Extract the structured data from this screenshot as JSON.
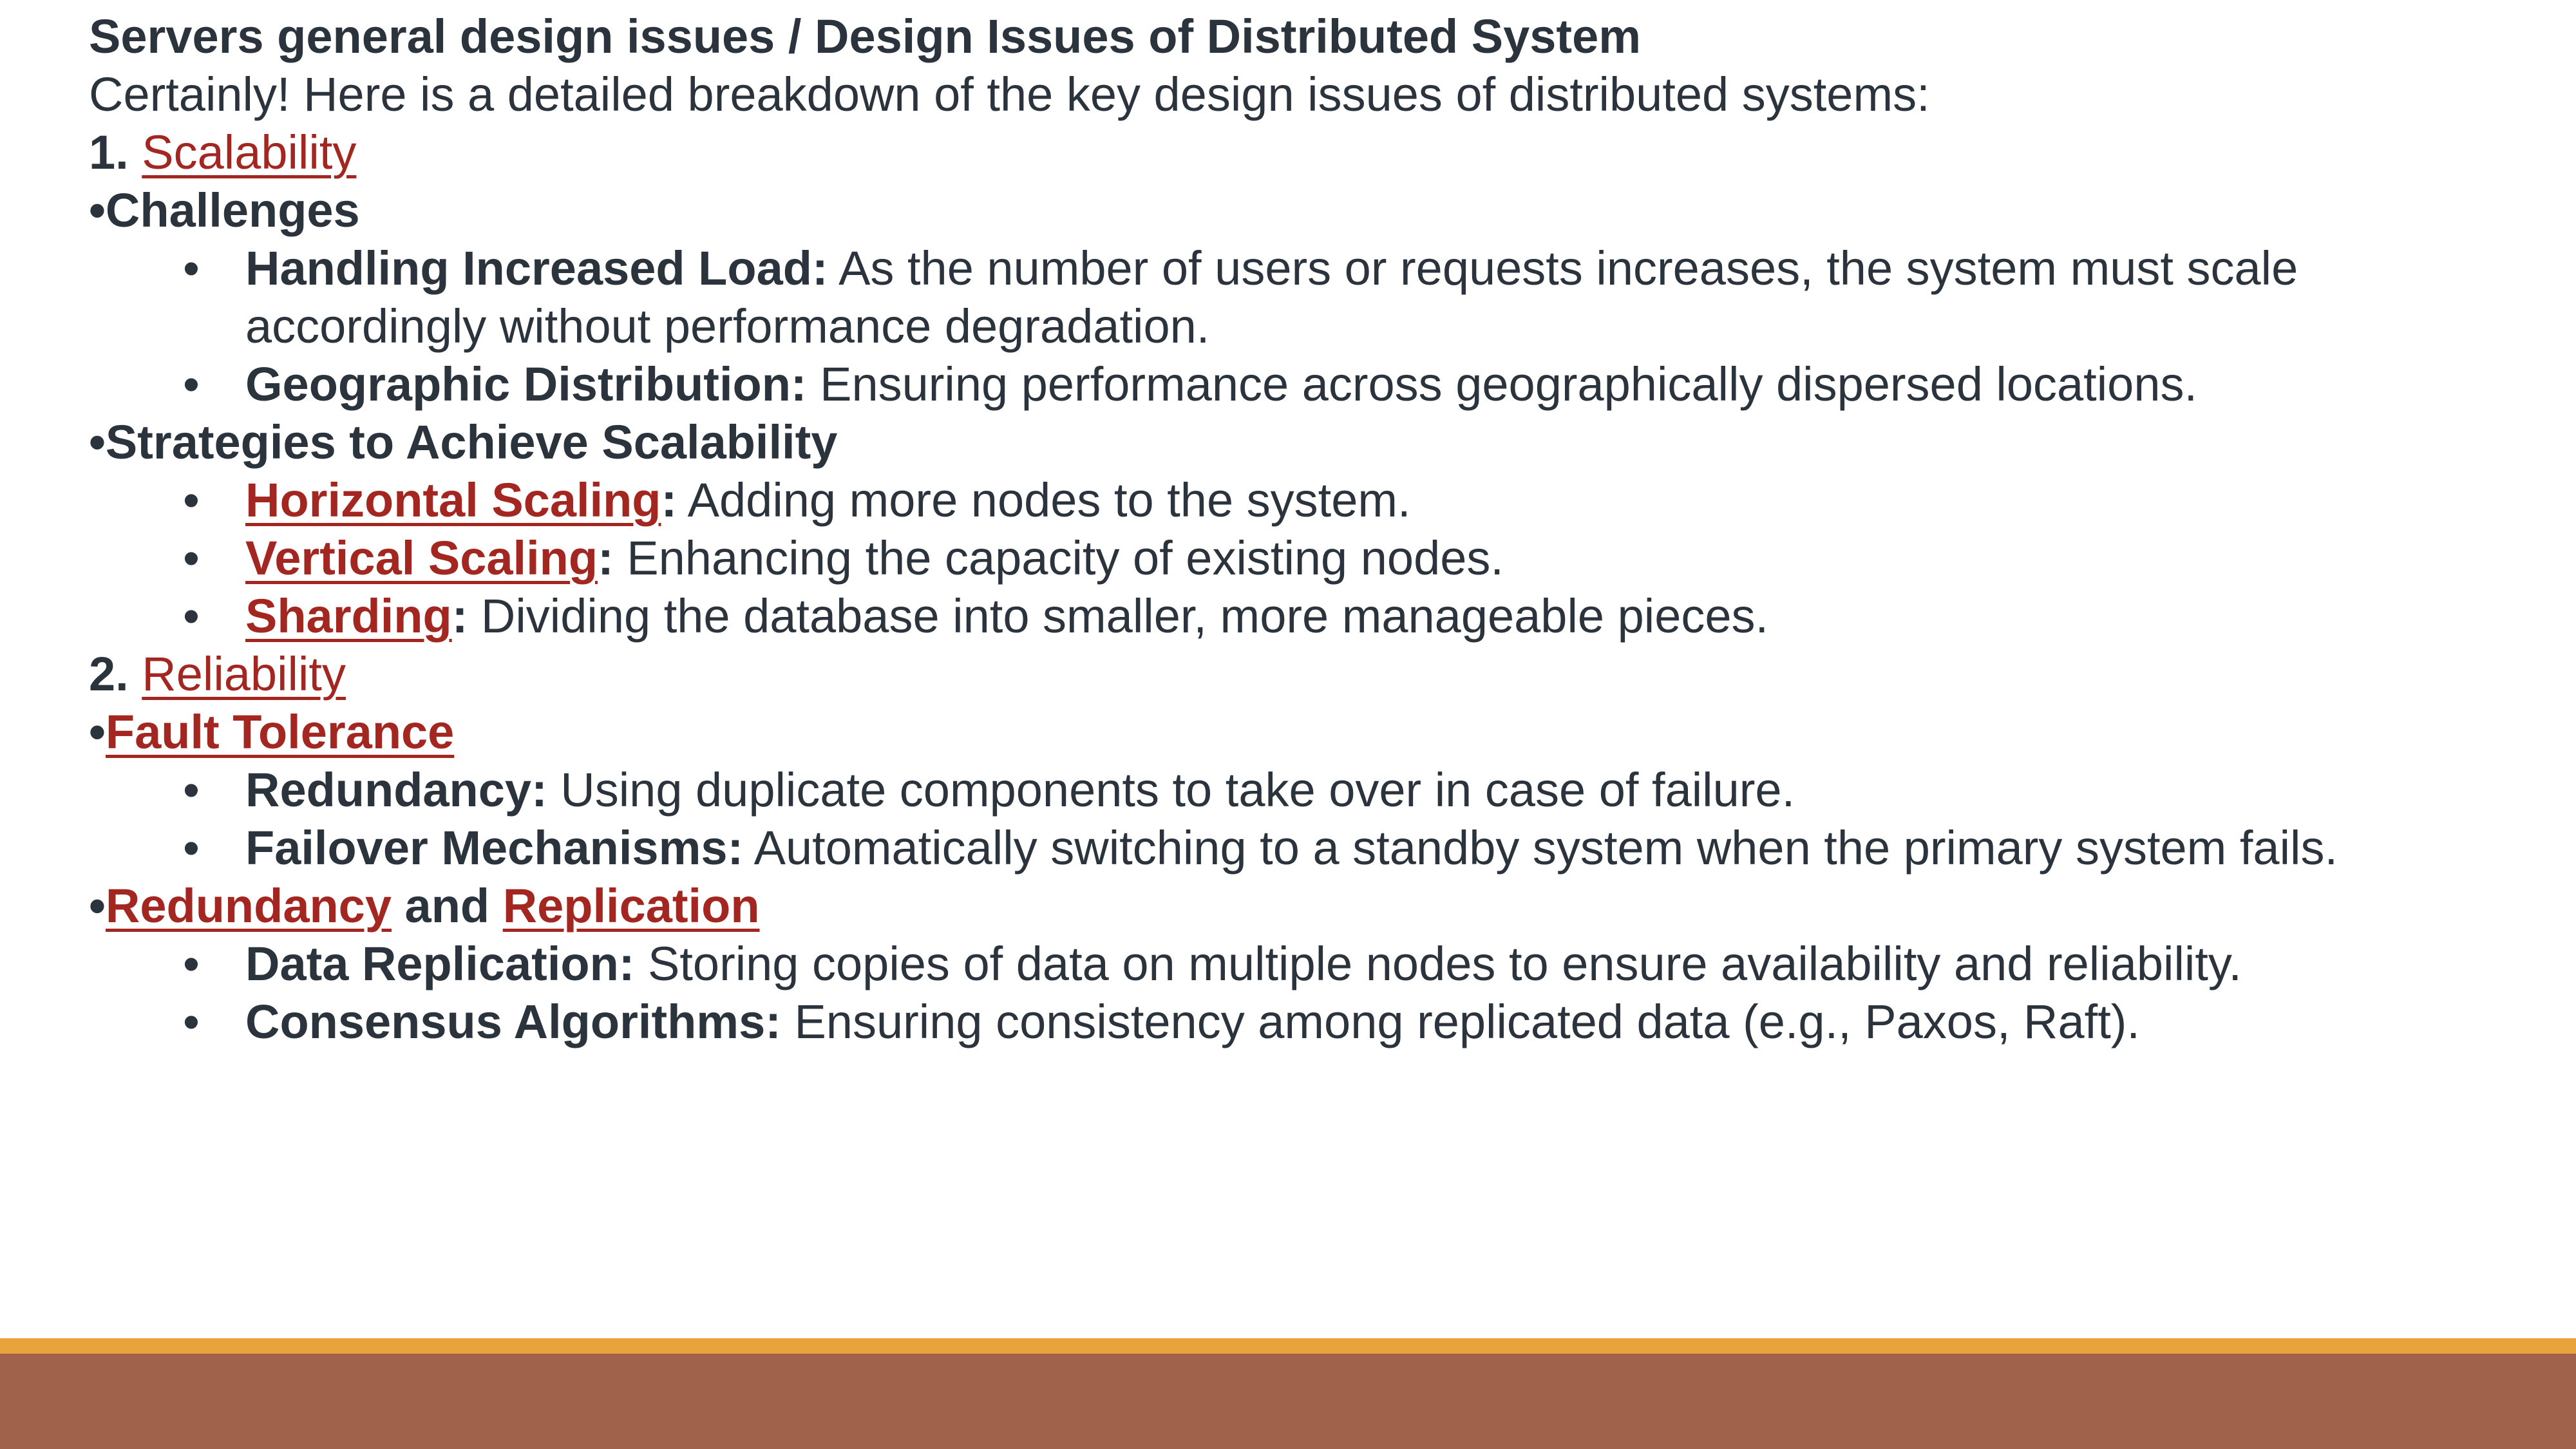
{
  "title": "Servers general design issues / Design Issues of Distributed System",
  "intro": "Certainly! Here is a detailed breakdown of the key design issues of distributed systems:",
  "section1": {
    "number": "1.",
    "heading": "Scalability",
    "challenges": {
      "bullet": "•",
      "label": "Challenges",
      "items": [
        {
          "term": "Handling Increased Load:",
          "text": " As the number of users or requests increases, the system must scale accordingly without performance degradation."
        },
        {
          "term": "Geographic Distribution:",
          "text": " Ensuring performance across geographically dispersed locations."
        }
      ]
    },
    "strategies": {
      "bullet": "•",
      "label": "Strategies to Achieve Scalability",
      "items": [
        {
          "term": "Horizontal Scaling",
          "colon": ":",
          "text": " Adding more nodes to the system."
        },
        {
          "term": "Vertical Scaling",
          "colon": ":",
          "text": " Enhancing the capacity of existing nodes."
        },
        {
          "term": "Sharding",
          "colon": ":",
          "text": " Dividing the database into smaller, more manageable pieces."
        }
      ]
    }
  },
  "section2": {
    "number": "2.",
    "heading": "Reliability",
    "fault_tolerance": {
      "bullet": "•",
      "label": "Fault Tolerance",
      "items": [
        {
          "term": "Redundancy:",
          "text": " Using duplicate components to take over in case of failure."
        },
        {
          "term": "Failover Mechanisms:",
          "text": " Automatically switching to a standby system when the primary system fails."
        }
      ]
    },
    "redundancy_replication": {
      "bullet": "•",
      "label_a": "Redundancy",
      "connector": " and ",
      "label_b": "Replication",
      "items": [
        {
          "term": "Data Replication:",
          "text": " Storing copies of data on multiple nodes to ensure availability and reliability."
        },
        {
          "term": "Consensus Algorithms:",
          "text": " Ensuring consistency among replicated data (e.g., Paxos, Raft)."
        }
      ]
    }
  },
  "sub_bullet_glyph": "•",
  "colors": {
    "text": "#2b333c",
    "link": "#a32620",
    "footer_orange": "#e8a33a",
    "footer_brown": "#a0624b"
  }
}
